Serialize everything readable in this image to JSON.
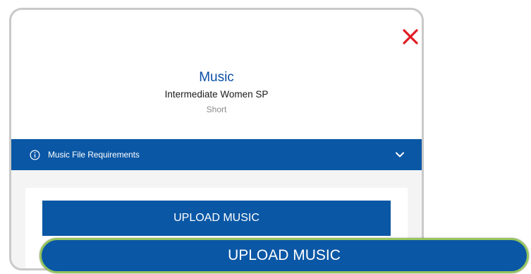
{
  "modal": {
    "title": "Music",
    "subtitle": "Intermediate Women SP",
    "segment": "Short",
    "requirements_label": "Music File Requirements",
    "inner_upload_label": "UPLOAD MUSIC"
  },
  "floating": {
    "upload_label": "UPLOAD MUSIC"
  },
  "icons": {
    "close": "close-icon",
    "info": "info-icon",
    "chevron": "chevron-down-icon"
  },
  "colors": {
    "primary": "#0a57a5",
    "title": "#0a4fa6",
    "close": "#e01b24",
    "highlight_border": "#95c45e"
  }
}
